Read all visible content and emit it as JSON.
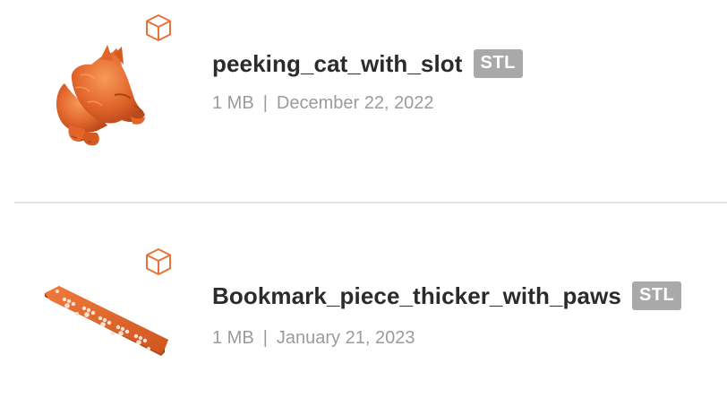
{
  "files": [
    {
      "name": "peeking_cat_with_slot",
      "type": "STL",
      "size": "1 MB",
      "separator": "|",
      "date": "December 22, 2022",
      "type_icon": "cube-icon",
      "thumbnail": "cat-model-thumbnail"
    },
    {
      "name": "Bookmark_piece_thicker_with_paws",
      "type": "STL",
      "size": "1 MB",
      "separator": "|",
      "date": "January 21, 2023",
      "type_icon": "cube-icon",
      "thumbnail": "bookmark-model-thumbnail"
    }
  ],
  "colors": {
    "accent": "#e8733a",
    "model": "#e2662c",
    "badge_bg": "#a9a9a9",
    "title_text": "#2b2b2b",
    "meta_text": "#9b9b9b",
    "divider": "#e4e4e4"
  }
}
